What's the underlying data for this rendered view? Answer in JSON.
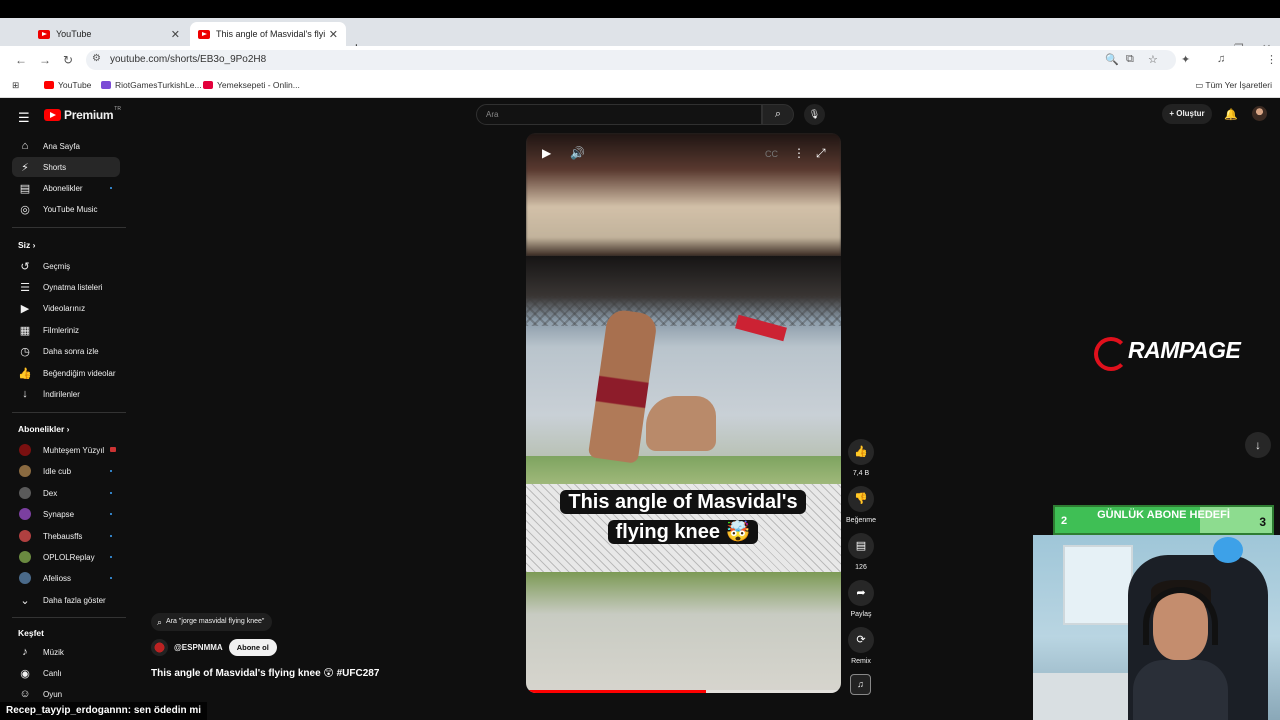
{
  "browser": {
    "tabs": [
      {
        "title": "YouTube",
        "active": false
      },
      {
        "title": "This angle of Masvidal's flying k",
        "active": true
      }
    ],
    "url": "youtube.com/shorts/EB3o_9Po2H8",
    "bookmarks": [
      {
        "label": "YouTube",
        "color": "#ff0000"
      },
      {
        "label": "RiotGamesTurkishLe...",
        "color": "#7b4bd6"
      },
      {
        "label": "Yemeksepeti - Onlin...",
        "color": "#e3003b"
      }
    ],
    "bookmarks_folder": "Tüm Yer İşaretleri"
  },
  "yt": {
    "logo_text": "Premium",
    "logo_region": "TR",
    "search_placeholder": "Ara",
    "create_label": "Oluştur",
    "sidebar": {
      "main": [
        {
          "label": "Ana Sayfa",
          "icon": "home-icon",
          "glyph": "⌂"
        },
        {
          "label": "Shorts",
          "icon": "shorts-icon",
          "glyph": "⚡",
          "active": true
        },
        {
          "label": "Abonelikler",
          "icon": "subscriptions-icon",
          "glyph": "▤",
          "dot": true
        },
        {
          "label": "YouTube Music",
          "icon": "music-icon",
          "glyph": "◎"
        }
      ],
      "you_header": "Siz",
      "you": [
        {
          "label": "Geçmiş",
          "icon": "history-icon",
          "glyph": "↺"
        },
        {
          "label": "Oynatma listeleri",
          "icon": "playlists-icon",
          "glyph": "☰"
        },
        {
          "label": "Videolarınız",
          "icon": "your-videos-icon",
          "glyph": "▶"
        },
        {
          "label": "Filmleriniz",
          "icon": "movies-icon",
          "glyph": "▦"
        },
        {
          "label": "Daha sonra izle",
          "icon": "watch-later-icon",
          "glyph": "◷"
        },
        {
          "label": "Beğendiğim videolar",
          "icon": "liked-icon",
          "glyph": "👍"
        },
        {
          "label": "İndirilenler",
          "icon": "downloads-icon",
          "glyph": "↓"
        }
      ],
      "subs_header": "Abonelikler",
      "subs": [
        {
          "label": "Muhteşem Yüzyıl",
          "color": "#7a1010",
          "live": true
        },
        {
          "label": "Idle cub",
          "color": "#8a6a40",
          "dot": true
        },
        {
          "label": "Dex",
          "color": "#5a5a5a",
          "dot": true
        },
        {
          "label": "Synapse",
          "color": "#7b3fa0",
          "dot": true
        },
        {
          "label": "Thebausffs",
          "color": "#b04040",
          "dot": true
        },
        {
          "label": "OPLOLReplay",
          "color": "#6a8a40",
          "dot": true
        },
        {
          "label": "Afelioss",
          "color": "#4a6a8a",
          "dot": true
        }
      ],
      "show_more": "Daha fazla göster",
      "explore_header": "Keşfet",
      "explore": [
        {
          "label": "Müzik",
          "icon": "music-note-icon",
          "glyph": "♪"
        },
        {
          "label": "Canlı",
          "icon": "live-icon",
          "glyph": "((•))"
        },
        {
          "label": "Oyun",
          "icon": "gaming-icon",
          "glyph": "🎮"
        }
      ]
    },
    "short": {
      "caption_line1": "This angle of Masvidal's",
      "caption_line2": "flying knee 🤯",
      "progress": 0.57,
      "search_chip": "Ara \"jorge masvidal flying knee\"",
      "channel": "@ESPNMMA",
      "subscribe": "Abone ol",
      "title": "This angle of Masvidal's flying knee 😲 #UFC287"
    },
    "actions": {
      "likes": "7,4 B",
      "dislike": "Beğenme",
      "comments": "126",
      "share": "Paylaş",
      "remix": "Remix"
    }
  },
  "stream": {
    "brand": "RAMPAGE",
    "goal_title": "GÜNLÜK ABONE HEDEFİ",
    "goal_current": "2",
    "goal_target": "3",
    "goal_progress": 0.67,
    "chat_user": "Recep_tayyip_erdogannn",
    "chat_message": ": sen ödedin mi"
  }
}
